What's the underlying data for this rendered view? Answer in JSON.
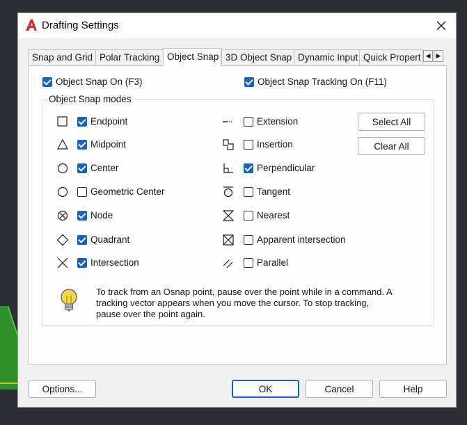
{
  "window": {
    "title": "Drafting Settings",
    "icon": "autocad-a-icon",
    "close_icon": "close-icon"
  },
  "tabs": [
    {
      "label": "Snap and Grid",
      "active": false
    },
    {
      "label": "Polar Tracking",
      "active": false
    },
    {
      "label": "Object Snap",
      "active": true
    },
    {
      "label": "3D Object Snap",
      "active": false
    },
    {
      "label": "Dynamic Input",
      "active": false
    },
    {
      "label": "Quick Propert",
      "active": false
    }
  ],
  "tab_scroll": {
    "left": "◀",
    "right": "▶"
  },
  "object_snap_on": {
    "label": "Object Snap On (F3)",
    "checked": true
  },
  "object_snap_tracking_on": {
    "label": "Object Snap Tracking On (F11)",
    "checked": true
  },
  "modes_group_label": "Object Snap modes",
  "modes_left": [
    {
      "label": "Endpoint",
      "checked": true,
      "symbol": "square"
    },
    {
      "label": "Midpoint",
      "checked": true,
      "symbol": "triangle"
    },
    {
      "label": "Center",
      "checked": true,
      "symbol": "circle"
    },
    {
      "label": "Geometric Center",
      "checked": false,
      "symbol": "circle"
    },
    {
      "label": "Node",
      "checked": true,
      "symbol": "circle-x"
    },
    {
      "label": "Quadrant",
      "checked": true,
      "symbol": "diamond"
    },
    {
      "label": "Intersection",
      "checked": true,
      "symbol": "x"
    }
  ],
  "modes_right": [
    {
      "label": "Extension",
      "checked": false,
      "symbol": "extension"
    },
    {
      "label": "Insertion",
      "checked": false,
      "symbol": "insertion"
    },
    {
      "label": "Perpendicular",
      "checked": true,
      "symbol": "perpendicular"
    },
    {
      "label": "Tangent",
      "checked": false,
      "symbol": "tangent"
    },
    {
      "label": "Nearest",
      "checked": false,
      "symbol": "hourglass"
    },
    {
      "label": "Apparent intersection",
      "checked": false,
      "symbol": "box-x"
    },
    {
      "label": "Parallel",
      "checked": false,
      "symbol": "parallel"
    }
  ],
  "select_all_label": "Select All",
  "clear_all_label": "Clear All",
  "info": {
    "icon": "lightbulb-icon",
    "line1": "To track from an Osnap point, pause over the point while in a command.  A",
    "line2": "tracking vector appears when you move the cursor.  To stop tracking,",
    "line3": "pause over the point again."
  },
  "footer": {
    "options": "Options...",
    "ok": "OK",
    "cancel": "Cancel",
    "help": "Help"
  },
  "colors": {
    "accent": "#1565c0",
    "app_icon_red": "#d92b2b"
  }
}
